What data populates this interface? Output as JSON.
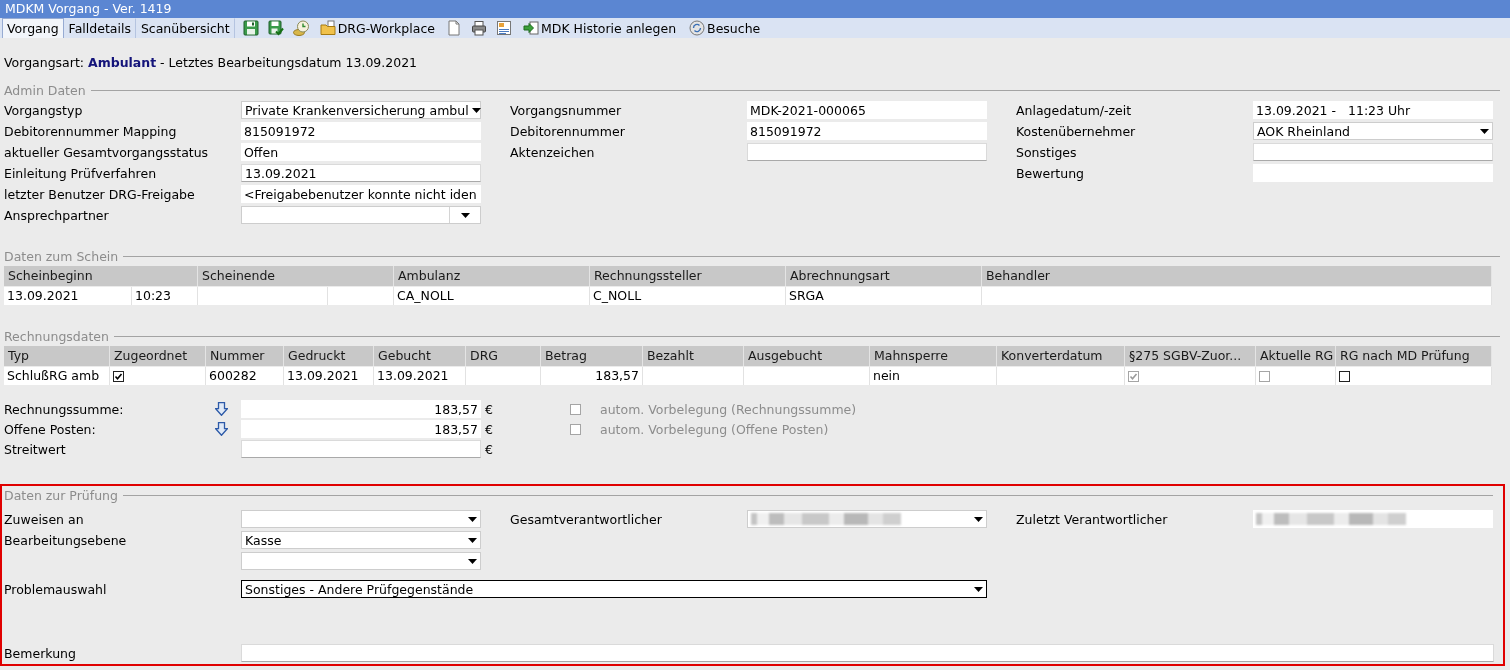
{
  "window": {
    "title": "MDKM Vorgang - Ver. 1419"
  },
  "tabs": [
    {
      "label": "Vorgang",
      "selected": true
    },
    {
      "label": "Falldetails",
      "selected": false
    },
    {
      "label": "Scanübersicht",
      "selected": false
    }
  ],
  "toolbar": {
    "buttons": [
      {
        "label": "DRG-Workplace"
      },
      {
        "label": "MDK Historie anlegen"
      },
      {
        "label": "Besuche"
      }
    ]
  },
  "summary": "Vorgangsart: **Ambulant** - Letztes Bearbeitungsdatum 13.09.2021",
  "admin_data": {
    "title": "Admin Daten",
    "columns": [
      [
        {
          "label": "Vorgangstyp",
          "kind": "dropdown",
          "value": "Private Krankenversicherung ambul"
        },
        {
          "label": "Debitorennummer Mapping",
          "kind": "readonly",
          "value": "815091972"
        },
        {
          "label": "aktueller Gesamtvorgangsstatus",
          "kind": "readonly",
          "value": "Offen"
        },
        {
          "label": "Einleitung Prüfverfahren",
          "kind": "input",
          "value": "13.09.2021"
        },
        {
          "label": "letzter Benutzer DRG-Freigabe",
          "kind": "readonly",
          "value": "<Freigabebenutzer konnte nicht iden"
        },
        {
          "label": "Ansprechpartner",
          "kind": "combo"
        }
      ],
      [
        {
          "label": "Vorgangsnummer",
          "kind": "readonly",
          "value": "MDK-2021-000065"
        },
        {
          "label": "Debitorennummer",
          "kind": "readonly",
          "value": "815091972"
        },
        {
          "label": "Aktenzeichen",
          "kind": "input"
        }
      ],
      [
        {
          "label": "Anlagedatum/-zeit",
          "kind": "readonly",
          "value": "13.09.2021 -   11:23 Uhr"
        },
        {
          "label": "Kostenübernehmer",
          "kind": "dropdown",
          "value": "AOK Rheinland"
        },
        {
          "label": "Sonstiges",
          "kind": "input"
        },
        {
          "label": "Bewertung",
          "kind": "readonly"
        }
      ]
    ]
  },
  "schein": {
    "title": "Daten zum Schein",
    "columns": [
      "Scheinbeginn",
      "Scheinende",
      "Ambulanz",
      "Rechnungssteller",
      "Abrechnungsart",
      "Behandler"
    ],
    "rows": [
      {
        "scheinbeginn_date": "13.09.2021",
        "scheinbeginn_time": "10:23",
        "ambulanz": "CA_NOLL",
        "rechnungssteller": "C_NOLL",
        "abrechnungsart": "SRGA"
      }
    ]
  },
  "invoices": {
    "title": "Rechnungsdaten",
    "columns": [
      "Typ",
      "Zugeordnet",
      "Nummer",
      "Gedruckt",
      "Gebucht",
      "DRG",
      "Betrag",
      "Bezahlt",
      "Ausgebucht",
      "Mahnsperre",
      "Konverterdatum",
      "§275 SGBV-Zuor...",
      "Aktuelle RG",
      "RG nach MD Prüfung"
    ],
    "rows": [
      {
        "typ": "SchlußRG amb",
        "zugeordnet": {
          "checked": true,
          "disabled": false
        },
        "nummer": "600282",
        "gedruckt": "13.09.2021",
        "gebucht": "13.09.2021",
        "betrag": "183,57",
        "mahnsperre": "nein",
        "sgbv_275": {
          "checked": true,
          "disabled": true
        },
        "aktuelle_rg": {
          "checked": false,
          "disabled": true
        },
        "rg_nach_md_pruefung": {
          "checked": false,
          "disabled": false
        }
      }
    ]
  },
  "totals": [
    {
      "label": "Rechnungssumme:",
      "apply_button": true,
      "kind": "readonly",
      "value": "183,57",
      "currency": "€",
      "auto_fill": {
        "label": "autom. Vorbelegung (Rechnungssumme)",
        "checked": false,
        "disabled": true
      }
    },
    {
      "label": "Offene Posten:",
      "apply_button": true,
      "kind": "readonly",
      "value": "183,57",
      "currency": "€",
      "auto_fill": {
        "label": "autom. Vorbelegung (Offene Posten)",
        "checked": false,
        "disabled": true
      }
    },
    {
      "label": "Streitwert",
      "kind": "input",
      "currency": "€"
    }
  ],
  "review": {
    "title": "Daten zur Prüfung",
    "highlighted": true,
    "columns": [
      [
        {
          "label": "Zuweisen an",
          "kind": "dropdown"
        },
        {
          "label": "Bearbeitungsebene",
          "kind": "dropdown",
          "value": "Kasse"
        },
        {
          "kind": "dropdown"
        }
      ],
      [
        {
          "label": "Gesamtverantwortlicher",
          "kind": "dropdown",
          "redacted": true
        }
      ],
      [
        {
          "label": "Zuletzt Verantwortlicher",
          "kind": "readonly",
          "redacted": true
        }
      ]
    ],
    "problem": {
      "label": "Problemauswahl",
      "kind": "dropdown",
      "value": "Sonstiges - Andere Prüfgegenstände",
      "focused": true
    },
    "remark": {
      "label": "Bemerkung",
      "kind": "input"
    }
  }
}
